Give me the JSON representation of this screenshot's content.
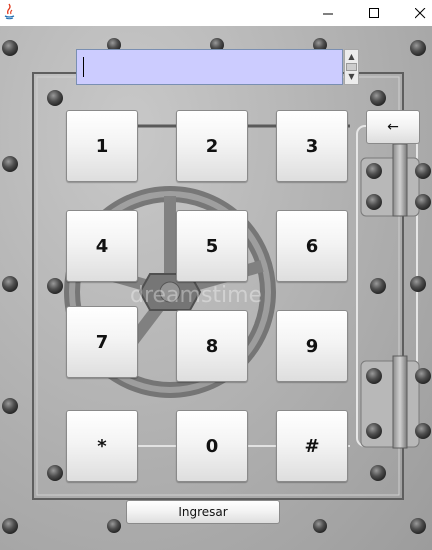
{
  "window": {
    "controls": {
      "minimize": "minimize-icon",
      "maximize": "maximize-icon",
      "close": "close-icon"
    },
    "app_icon": "java-icon"
  },
  "display": {
    "value": ""
  },
  "keypad": {
    "keys": [
      "1",
      "2",
      "3",
      "4",
      "5",
      "6",
      "7",
      "8",
      "9",
      "*",
      "0",
      "#"
    ]
  },
  "backspace_label": "←",
  "submit_label": "Ingresar",
  "background": {
    "description_icon": "vault-door-background",
    "watermark": "dreamstime"
  },
  "colors": {
    "display_bg": "#ccccff",
    "display_border": "#7a8fb2"
  }
}
